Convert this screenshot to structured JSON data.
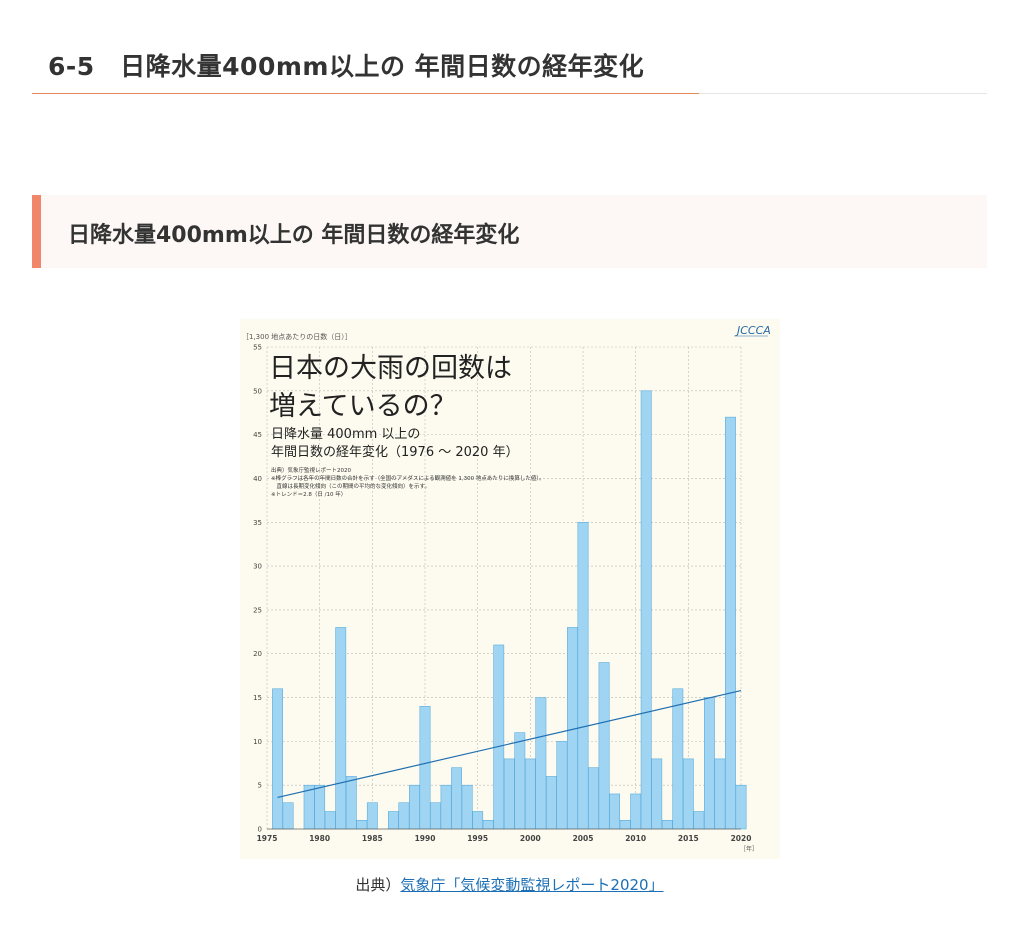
{
  "page": {
    "section_heading": "6-5　日降水量400mm以上の 年間日数の経年変化",
    "sub_heading": "日降水量400mm以上の 年間日数の経年変化",
    "caption_prefix": "出典）",
    "caption_link": "気象庁「気候変動監視レポート2020」"
  },
  "colors": {
    "accent": "#e88b5a",
    "sub_heading_bar": "#f0866a",
    "sub_heading_bg": "#fdf8f6",
    "chart_bg": "#fdfbef",
    "bar_fill": "#9fd4f2",
    "bar_stroke": "#4aa3d8",
    "trend_line": "#1f6fb0",
    "link": "#1c6fb5"
  },
  "chart_data": {
    "type": "bar",
    "logo": "JCCCA",
    "title_line1": "日本の大雨の回数は",
    "title_line2": "増えているの？",
    "subtitle_line1": "日降水量 400mm 以上の",
    "subtitle_line2": "年間日数の経年変化（1976 ～ 2020 年）",
    "notes": [
      "出典）気象庁監視レポート2020",
      "※棒グラフは各年の年間日数の合計を示す（全国のアメダスによる観測値を 1,300 地点あたりに換算した値）。",
      "　直線は長期変化傾向（この期間の平均的な変化傾向）を示す。",
      "※トレンド＝2.8（日 /10 年）"
    ],
    "ylabel": "［1,300 地点あたりの日数（日）］",
    "xlabel": "［年］",
    "ylim": [
      0,
      55
    ],
    "xlim": [
      1975,
      2020
    ],
    "y_ticks": [
      0,
      5,
      10,
      15,
      20,
      25,
      30,
      35,
      40,
      45,
      50,
      55
    ],
    "x_ticks": [
      1975,
      1980,
      1985,
      1990,
      1995,
      2000,
      2005,
      2010,
      2015,
      2020
    ],
    "grid": true,
    "years": [
      1976,
      1977,
      1978,
      1979,
      1980,
      1981,
      1982,
      1983,
      1984,
      1985,
      1986,
      1987,
      1988,
      1989,
      1990,
      1991,
      1992,
      1993,
      1994,
      1995,
      1996,
      1997,
      1998,
      1999,
      2000,
      2001,
      2002,
      2003,
      2004,
      2005,
      2006,
      2007,
      2008,
      2009,
      2010,
      2011,
      2012,
      2013,
      2014,
      2015,
      2016,
      2017,
      2018,
      2019,
      2020
    ],
    "values": [
      16,
      3,
      0,
      5,
      5,
      2,
      23,
      6,
      1,
      3,
      0,
      2,
      3,
      5,
      14,
      3,
      5,
      7,
      5,
      2,
      1,
      21,
      8,
      11,
      8,
      15,
      6,
      10,
      23,
      35,
      7,
      19,
      4,
      1,
      4,
      50,
      8,
      1,
      16,
      8,
      2,
      15,
      8,
      47,
      5
    ],
    "trend": {
      "start_year": 1976,
      "start_value": 3.6,
      "end_year": 2020,
      "end_value": 15.8
    }
  }
}
